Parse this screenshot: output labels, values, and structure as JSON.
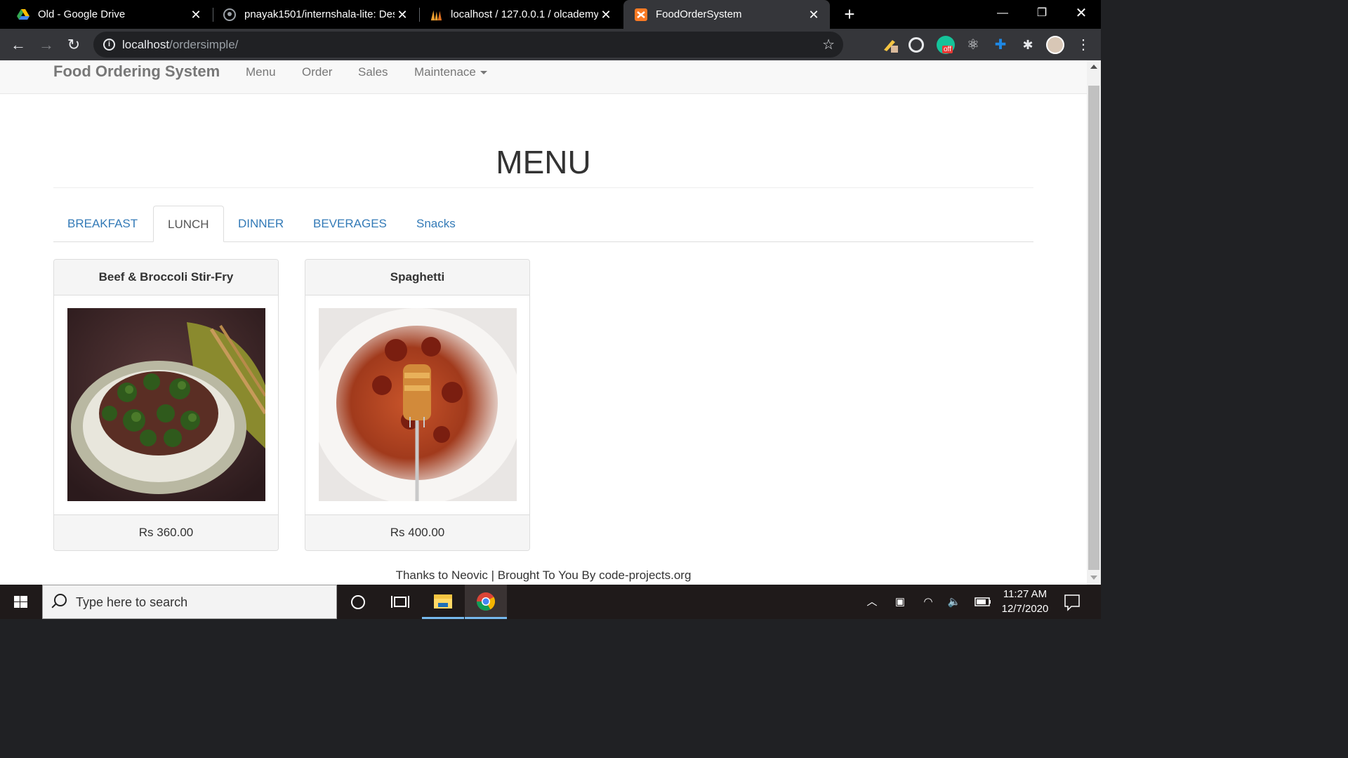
{
  "browser": {
    "tabs": [
      {
        "title": "Old - Google Drive",
        "favicon": "google-drive-icon"
      },
      {
        "title": "pnayak1501/internshala-lite: Des",
        "favicon": "github-icon"
      },
      {
        "title": "localhost / 127.0.0.1 / olcademy |",
        "favicon": "phpmyadmin-icon"
      },
      {
        "title": "FoodOrderSystem",
        "favicon": "xampp-icon"
      }
    ],
    "address": {
      "host": "localhost",
      "path": "/ordersimple/"
    },
    "extension_badge": "off"
  },
  "site": {
    "brand": "Food Ordering System",
    "nav": [
      "Menu",
      "Order",
      "Sales",
      "Maintenace"
    ],
    "heading": "MENU",
    "tabs": [
      "BREAKFAST",
      "LUNCH",
      "DINNER",
      "BEVERAGES",
      "Snacks"
    ],
    "active_tab": "LUNCH",
    "items": [
      {
        "name": "Beef & Broccoli Stir-Fry",
        "price": "Rs 360.00"
      },
      {
        "name": "Spaghetti",
        "price": "Rs 400.00"
      }
    ],
    "footer": "Thanks to Neovic | Brought To You By code-projects.org"
  },
  "taskbar": {
    "search_placeholder": "Type here to search",
    "time": "11:27 AM",
    "date": "12/7/2020"
  },
  "colors": {
    "link": "#337ab7",
    "navbar_bg": "#f8f8f8",
    "chrome_dark": "#35363a"
  }
}
